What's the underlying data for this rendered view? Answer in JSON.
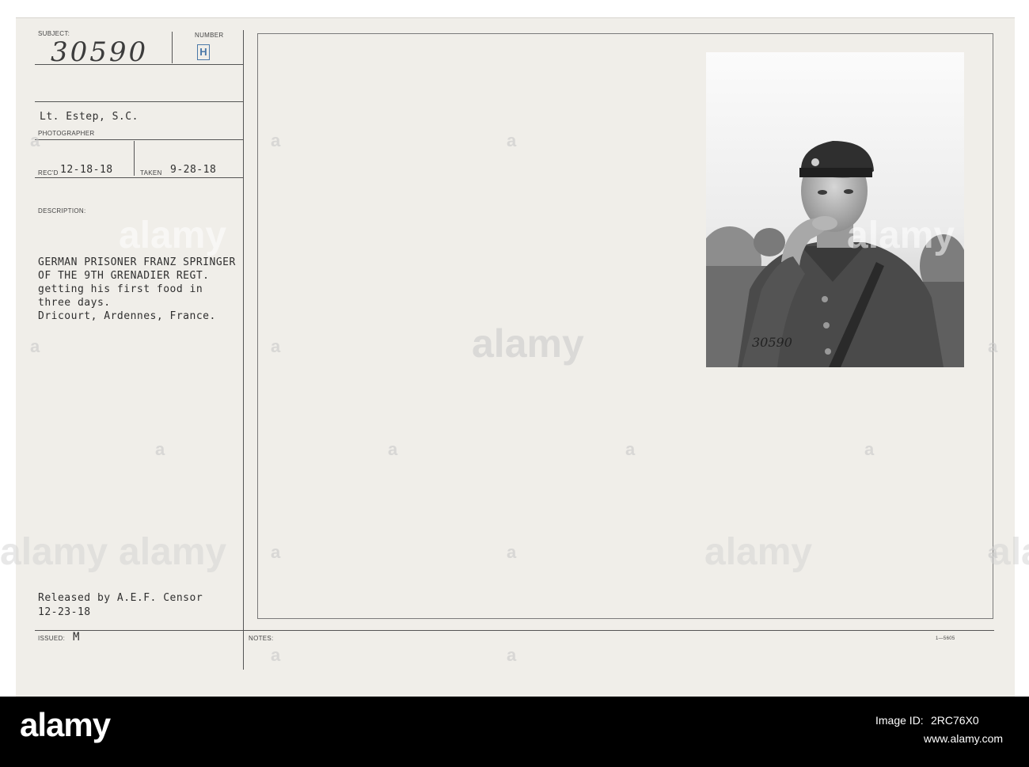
{
  "card": {
    "subject_label": "SUBJECT:",
    "subject_value": "30590",
    "number_label": "NUMBER",
    "number_value": "H",
    "photographer_value": "Lt. Estep, S.C.",
    "photographer_label": "PHOTOGRAPHER",
    "recd_label": "REC'D",
    "recd_value": "12-18-18",
    "taken_label": "TAKEN",
    "taken_value": "9-28-18",
    "description_label": "DESCRIPTION:",
    "description_lines": [
      "GERMAN PRISONER FRANZ SPRINGER",
      "OF THE 9TH GRENADIER REGT.",
      "getting his first food in",
      "three days.",
      "Dricourt, Ardennes, France."
    ],
    "released_line1": "Released by A.E.F. Censor",
    "released_line2": "12-23-18",
    "issued_label": "ISSUED:",
    "issued_value": "M",
    "notes_label": "NOTES:",
    "form_number": "1—5605",
    "photo_stamp": "30590"
  },
  "watermark": {
    "text": "alamy",
    "a_glyph": "a"
  },
  "footer": {
    "logo": "alamy",
    "image_id_label": "Image ID:",
    "image_id": "2RC76X0",
    "url": "www.alamy.com"
  }
}
